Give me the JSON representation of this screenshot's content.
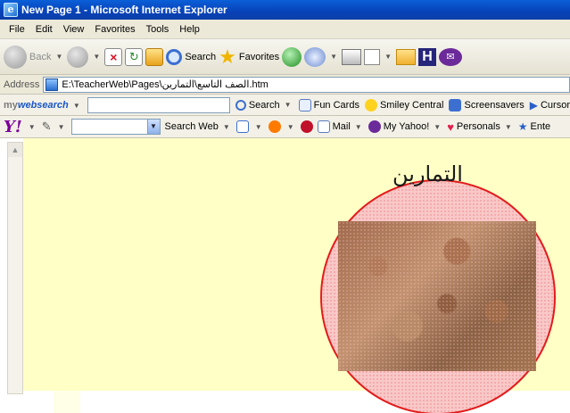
{
  "window": {
    "title": "New Page 1 - Microsoft Internet Explorer"
  },
  "menu": [
    "File",
    "Edit",
    "View",
    "Favorites",
    "Tools",
    "Help"
  ],
  "toolbar": {
    "back": "Back",
    "search": "Search",
    "favorites": "Favorites"
  },
  "address": {
    "label": "Address",
    "value": "E:\\TeacherWeb\\Pages\\الصف التاسع\\التمارين.htm"
  },
  "mywebsearch": {
    "logo_prefix": "my",
    "logo_main": "websearch",
    "search_label": "Search",
    "fun_cards": "Fun Cards",
    "smiley_central": "Smiley Central",
    "screensavers": "Screensavers",
    "cursor": "Cursor"
  },
  "yahoo": {
    "logo": "Y!",
    "search_web": "Search Web",
    "mail": "Mail",
    "my_yahoo": "My Yahoo!",
    "personals": "Personals",
    "enter": "Ente"
  },
  "page": {
    "heading": "التمارين"
  },
  "colors": {
    "page_bg": "#ffffc6",
    "circle_border": "#e31b1b"
  }
}
